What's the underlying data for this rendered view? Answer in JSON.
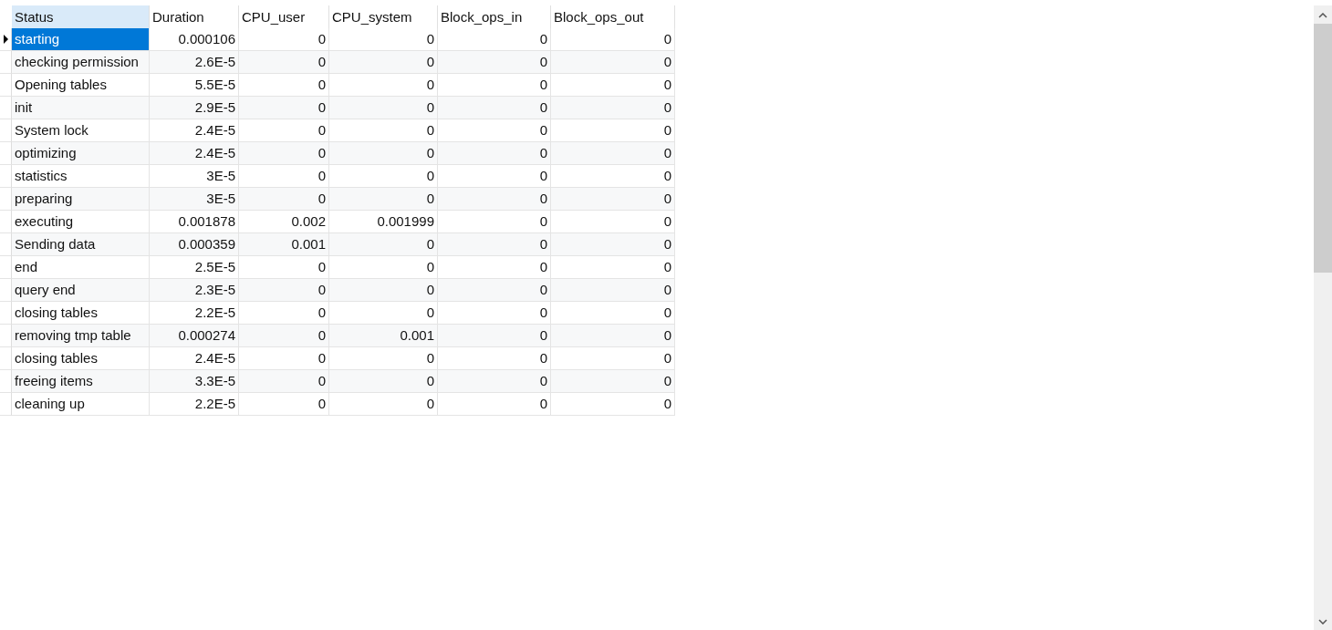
{
  "table": {
    "columns": [
      {
        "label": "Status",
        "selected": true
      },
      {
        "label": "Duration",
        "selected": false
      },
      {
        "label": "CPU_user",
        "selected": false
      },
      {
        "label": "CPU_system",
        "selected": false
      },
      {
        "label": "Block_ops_in",
        "selected": false
      },
      {
        "label": "Block_ops_out",
        "selected": false
      }
    ],
    "rows": [
      {
        "selected": true,
        "cells": [
          "starting",
          "0.000106",
          "0",
          "0",
          "0",
          "0"
        ]
      },
      {
        "selected": false,
        "cells": [
          "checking permission",
          "2.6E-5",
          "0",
          "0",
          "0",
          "0"
        ]
      },
      {
        "selected": false,
        "cells": [
          "Opening tables",
          "5.5E-5",
          "0",
          "0",
          "0",
          "0"
        ]
      },
      {
        "selected": false,
        "cells": [
          "init",
          "2.9E-5",
          "0",
          "0",
          "0",
          "0"
        ]
      },
      {
        "selected": false,
        "cells": [
          "System lock",
          "2.4E-5",
          "0",
          "0",
          "0",
          "0"
        ]
      },
      {
        "selected": false,
        "cells": [
          "optimizing",
          "2.4E-5",
          "0",
          "0",
          "0",
          "0"
        ]
      },
      {
        "selected": false,
        "cells": [
          "statistics",
          "3E-5",
          "0",
          "0",
          "0",
          "0"
        ]
      },
      {
        "selected": false,
        "cells": [
          "preparing",
          "3E-5",
          "0",
          "0",
          "0",
          "0"
        ]
      },
      {
        "selected": false,
        "cells": [
          "executing",
          "0.001878",
          "0.002",
          "0.001999",
          "0",
          "0"
        ]
      },
      {
        "selected": false,
        "cells": [
          "Sending data",
          "0.000359",
          "0.001",
          "0",
          "0",
          "0"
        ]
      },
      {
        "selected": false,
        "cells": [
          "end",
          "2.5E-5",
          "0",
          "0",
          "0",
          "0"
        ]
      },
      {
        "selected": false,
        "cells": [
          "query end",
          "2.3E-5",
          "0",
          "0",
          "0",
          "0"
        ]
      },
      {
        "selected": false,
        "cells": [
          "closing tables",
          "2.2E-5",
          "0",
          "0",
          "0",
          "0"
        ]
      },
      {
        "selected": false,
        "cells": [
          "removing tmp table",
          "0.000274",
          "0",
          "0.001",
          "0",
          "0"
        ]
      },
      {
        "selected": false,
        "cells": [
          "closing tables",
          "2.4E-5",
          "0",
          "0",
          "0",
          "0"
        ]
      },
      {
        "selected": false,
        "cells": [
          "freeing items",
          "3.3E-5",
          "0",
          "0",
          "0",
          "0"
        ]
      },
      {
        "selected": false,
        "cells": [
          "cleaning up",
          "2.2E-5",
          "0",
          "0",
          "0",
          "0"
        ]
      }
    ]
  }
}
